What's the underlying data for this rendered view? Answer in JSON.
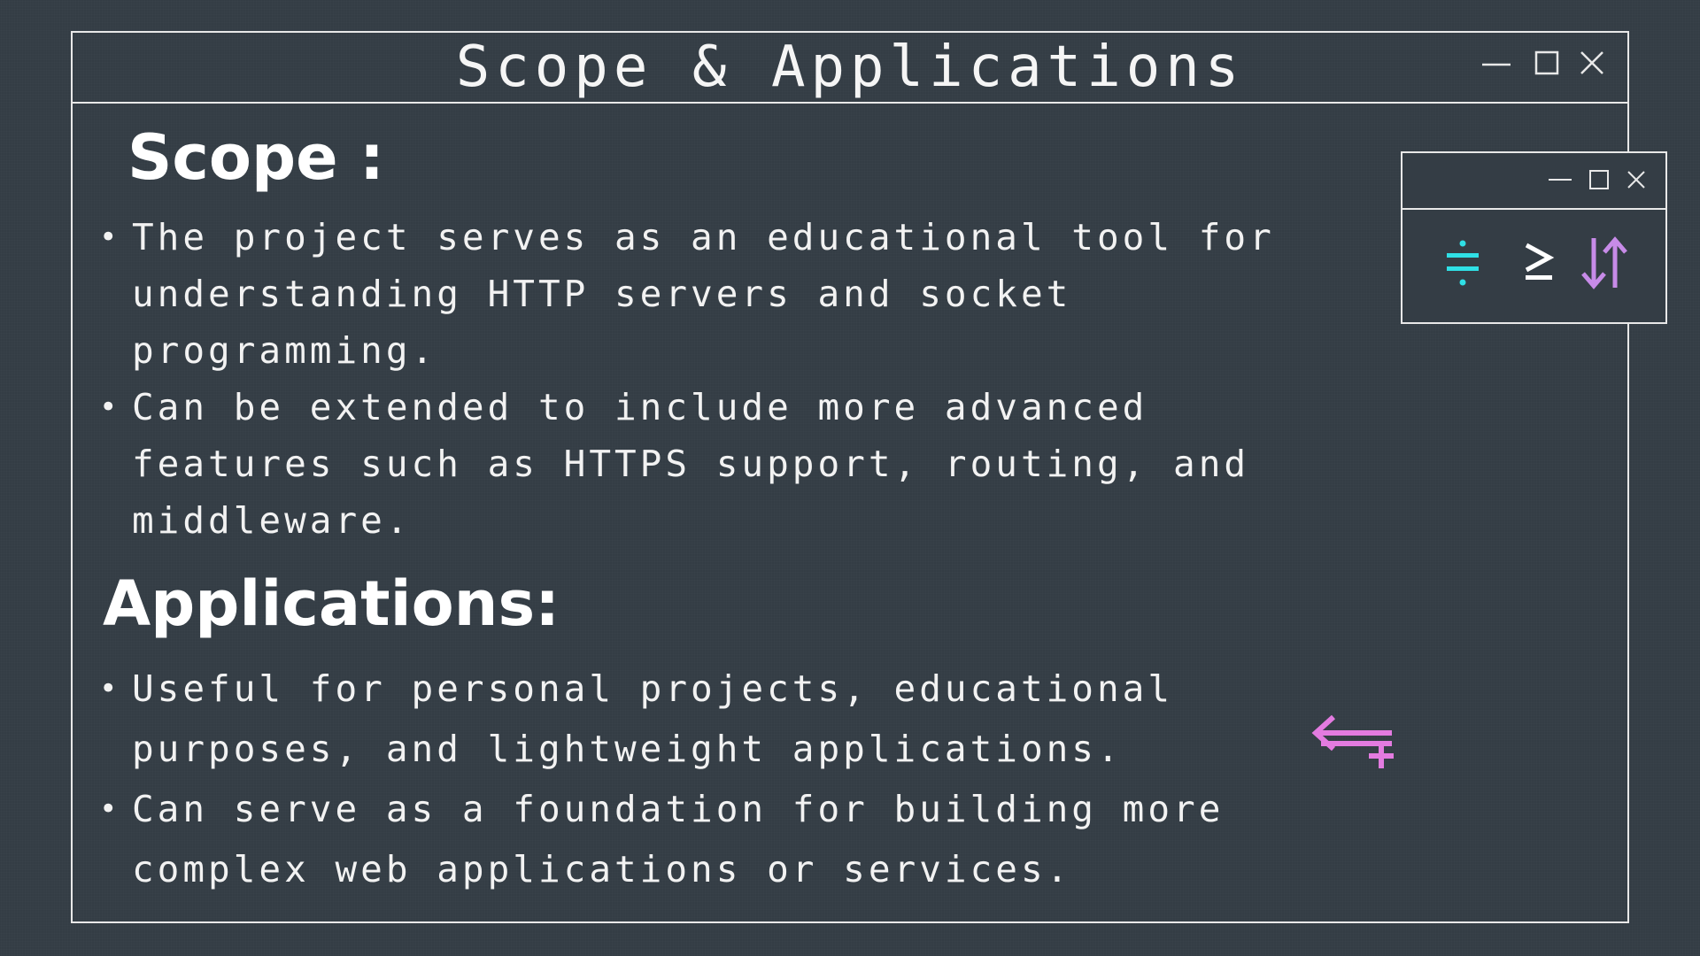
{
  "window": {
    "title": "Scope & Applications",
    "controls": [
      "minimize-icon",
      "maximize-icon",
      "close-icon"
    ]
  },
  "scope": {
    "heading": "Scope :",
    "items": [
      {
        "lines": [
          "The project serves as an educational tool for",
          "understanding HTTP servers and socket",
          "programming."
        ]
      },
      {
        "lines": [
          "Can be extended to include more advanced",
          "features such as HTTPS support, routing, and",
          "middleware."
        ]
      }
    ]
  },
  "applications": {
    "heading": "Applications:",
    "items": [
      {
        "lines": [
          "Useful for personal projects, educational",
          "purposes, and lightweight applications."
        ]
      },
      {
        "lines": [
          "Can serve as a foundation for building more",
          "complex web applications or services."
        ]
      }
    ]
  },
  "mini_window": {
    "controls": [
      "minimize-icon",
      "maximize-icon",
      "close-icon"
    ],
    "symbols": [
      {
        "name": "division-icon",
        "glyph": "≑",
        "color": "#2fe0e6"
      },
      {
        "name": "greater-equal-icon",
        "glyph": "≥",
        "color": "#ffffff"
      },
      {
        "name": "swap-arrows-icon",
        "glyph": "⇅",
        "color": "#c78be8"
      }
    ]
  },
  "decoration": {
    "name": "arrow-plus-icon",
    "color": "#e37be0"
  },
  "colors": {
    "background": "#343d45",
    "border": "#e8e8e8",
    "accent_cyan": "#2fe0e6",
    "accent_magenta": "#e37be0",
    "accent_purple": "#c78be8"
  }
}
